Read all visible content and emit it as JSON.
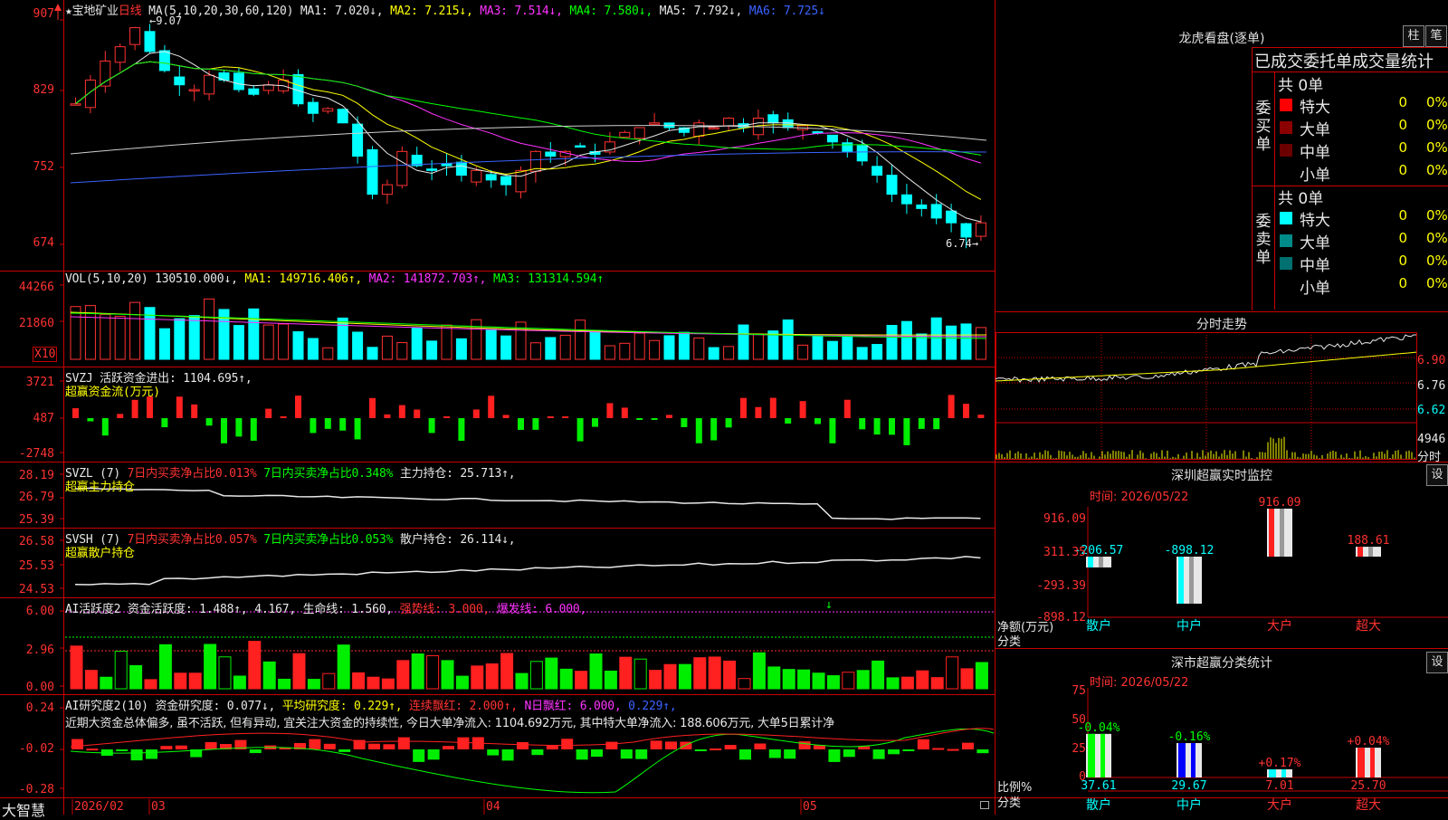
{
  "app": {
    "name": "大智慧"
  },
  "stock": {
    "star": "★",
    "name": "宝地矿业",
    "period": "日线"
  },
  "main": {
    "ma_title": "MA(5,10,20,30,60,120)",
    "ma": [
      {
        "label": "MA1: 7.020↓,",
        "color": "#e8e8e8"
      },
      {
        "label": "MA2: 7.215↓,",
        "color": "#ffff00"
      },
      {
        "label": "MA3: 7.514↓,",
        "color": "#ff33ff"
      },
      {
        "label": "MA4: 7.580↓,",
        "color": "#00ff00"
      },
      {
        "label": "MA5: 7.792↓,",
        "color": "#e8e8e8"
      },
      {
        "label": "MA6: 7.725↓",
        "color": "#3b63ff"
      }
    ],
    "y_labels": [
      "907",
      "829",
      "752",
      "674"
    ],
    "high_mark": "9.07",
    "low_mark": "6.74"
  },
  "vol": {
    "title": "VOL(5,10,20)",
    "value": "130510.000↓,",
    "ma1": "MA1: 149716.406↑,",
    "ma2": "MA2: 141872.703↑,",
    "ma3": "MA3: 131314.594↑",
    "y_labels": [
      "44266",
      "21860"
    ],
    "unit": "X10"
  },
  "svzj": {
    "title": "SVZJ",
    "label": "活跃资金进出: 1104.695↑,",
    "subtitle": "超赢资金流(万元)",
    "y_labels": [
      "3721",
      "487",
      "-2748"
    ]
  },
  "svzl": {
    "title": "SVZL (7)",
    "s1": "7日内买卖净占比0.013%",
    "s2": "7日内买卖净占比0.348%",
    "s3": "主力持仓: 25.713↑,",
    "subtitle": "超赢主力持仓",
    "y_labels": [
      "28.19",
      "26.79",
      "25.39"
    ]
  },
  "svsh": {
    "title": "SVSH (7)",
    "s1": "7日内买卖净占比0.057%",
    "s2": "7日内买卖净占比0.053%",
    "s3": "散户持仓: 26.114↓,",
    "subtitle": "超赢散户持仓",
    "y_labels": [
      "26.58",
      "25.53",
      "24.53"
    ]
  },
  "ai_active": {
    "title": "AI活跃度2",
    "s1": "资金活跃度: 1.488↑,",
    "s2": "4.167,",
    "s3": "生命线: 1.560,",
    "s4": "强势线: 3.000,",
    "s5": "爆发线: 6.000,",
    "y_labels": [
      "6.00",
      "2.96",
      "0.00"
    ]
  },
  "ai_research": {
    "title": "AI研究度2(10)",
    "s1": "资金研究度: 0.077↓,",
    "s2": "平均研究度: 0.229↑,",
    "s3": "连续飘红: 2.000↑,",
    "s4": "N日飘红: 6.000,",
    "s5": "0.229↑,",
    "comment": "近期大资金总体偏多, 虽不活跃, 但有异动, 宜关注大资金的持续性, 今日大单净流入: 1104.692万元, 其中特大单净流入: 188.606万元, 大单5日累计净",
    "y_labels": [
      "0.24",
      "-0.02",
      "-0.28"
    ]
  },
  "xaxis": {
    "labels": [
      "2026/02",
      "03",
      "04",
      "05"
    ]
  },
  "dragon": {
    "title": "龙虎看盘(逐单)",
    "btn1": "柱",
    "btn2": "笔",
    "header": "已成交委托单成交量统计",
    "buy_label": "委买单",
    "sell_label": "委卖单",
    "buy_total": "共 0单",
    "sell_total": "共 0单",
    "buy_rows": [
      {
        "label": "特大",
        "count": "0",
        "pct": "0%",
        "color": "#ff0000"
      },
      {
        "label": "大单",
        "count": "0",
        "pct": "0%",
        "color": "#8b0000"
      },
      {
        "label": "中单",
        "count": "0",
        "pct": "0%",
        "color": "#6b0000"
      },
      {
        "label": "小单",
        "count": "0",
        "pct": "0%",
        "color": "#000000"
      }
    ],
    "sell_rows": [
      {
        "label": "特大",
        "count": "0",
        "pct": "0%",
        "color": "#00ffff"
      },
      {
        "label": "大单",
        "count": "0",
        "pct": "0%",
        "color": "#008b8b"
      },
      {
        "label": "中单",
        "count": "0",
        "pct": "0%",
        "color": "#007070"
      },
      {
        "label": "小单",
        "count": "0",
        "pct": "0%",
        "color": "#000000"
      }
    ]
  },
  "intraday": {
    "title": "分时走势",
    "y_labels": [
      "6.90",
      "6.76",
      "6.62"
    ],
    "vol_label": "4946",
    "vol_unit": "分时"
  },
  "sz_monitor": {
    "title": "深圳超赢实时监控",
    "settings": "设",
    "time_label": "时间: 2026/05/22",
    "y_labels": [
      "916.09",
      "311.35",
      "-293.39",
      "-898.12"
    ],
    "y_title": "净额(万元)",
    "x_title": "分类",
    "categories": [
      "散户",
      "中户",
      "大户",
      "超大"
    ],
    "values": [
      -206.57,
      -898.12,
      916.09,
      188.61
    ],
    "value_labels": [
      "-206.57",
      "-898.12",
      "916.09",
      "188.61"
    ]
  },
  "sz_classify": {
    "title": "深市超赢分类统计",
    "settings": "设",
    "time_label": "时间: 2026/05/22",
    "y_labels": [
      "75",
      "50",
      "25",
      "0"
    ],
    "y_title": "比例%",
    "x_title": "分类",
    "categories": [
      "散户",
      "中户",
      "大户",
      "超大"
    ],
    "values": [
      37.61,
      29.67,
      7.01,
      25.7
    ],
    "value_labels": [
      "37.61",
      "29.67",
      "7.01",
      "25.70"
    ],
    "changes": [
      "-0.04%",
      "-0.16%",
      "+0.17%",
      "+0.04%"
    ]
  }
}
